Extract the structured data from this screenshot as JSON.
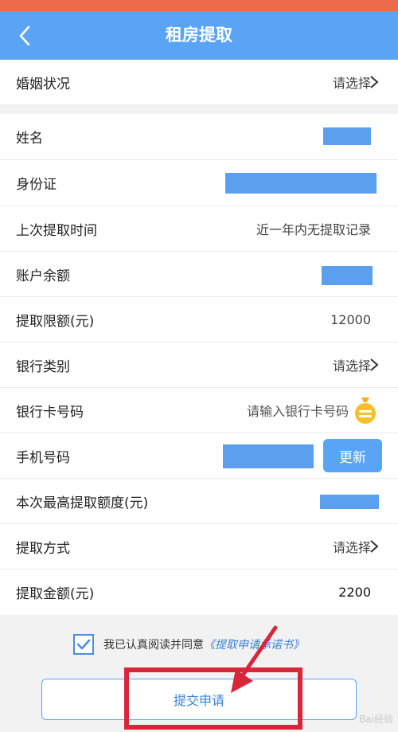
{
  "header": {
    "title": "租房提取"
  },
  "rows": {
    "marital": {
      "label": "婚姻状况",
      "value": "请选择"
    },
    "name": {
      "label": "姓名"
    },
    "id": {
      "label": "身份证"
    },
    "last_withdraw": {
      "label": "上次提取时间",
      "value": "近一年内无提取记录"
    },
    "balance": {
      "label": "账户余额"
    },
    "limit": {
      "label": "提取限额(元)",
      "value": "12000"
    },
    "bank_type": {
      "label": "银行类别",
      "value": "请选择"
    },
    "card_no": {
      "label": "银行卡号码",
      "placeholder": "请输入银行卡号码"
    },
    "phone": {
      "label": "手机号码",
      "button": "更新"
    },
    "max_amount": {
      "label": "本次最高提取额度(元)"
    },
    "method": {
      "label": "提取方式",
      "value": "请选择"
    },
    "amount": {
      "label": "提取金额(元)",
      "value": "2200"
    }
  },
  "agreement": {
    "text": "我已认真阅读并同意",
    "link": "《提取申请承诺书》",
    "checked": true
  },
  "submit": {
    "label": "提交申请"
  },
  "watermark": "Bai经验",
  "colors": {
    "header": "#5aa4f6",
    "mask": "#5aa0ef",
    "highlight": "#d8263a",
    "link": "#3b82d6"
  }
}
